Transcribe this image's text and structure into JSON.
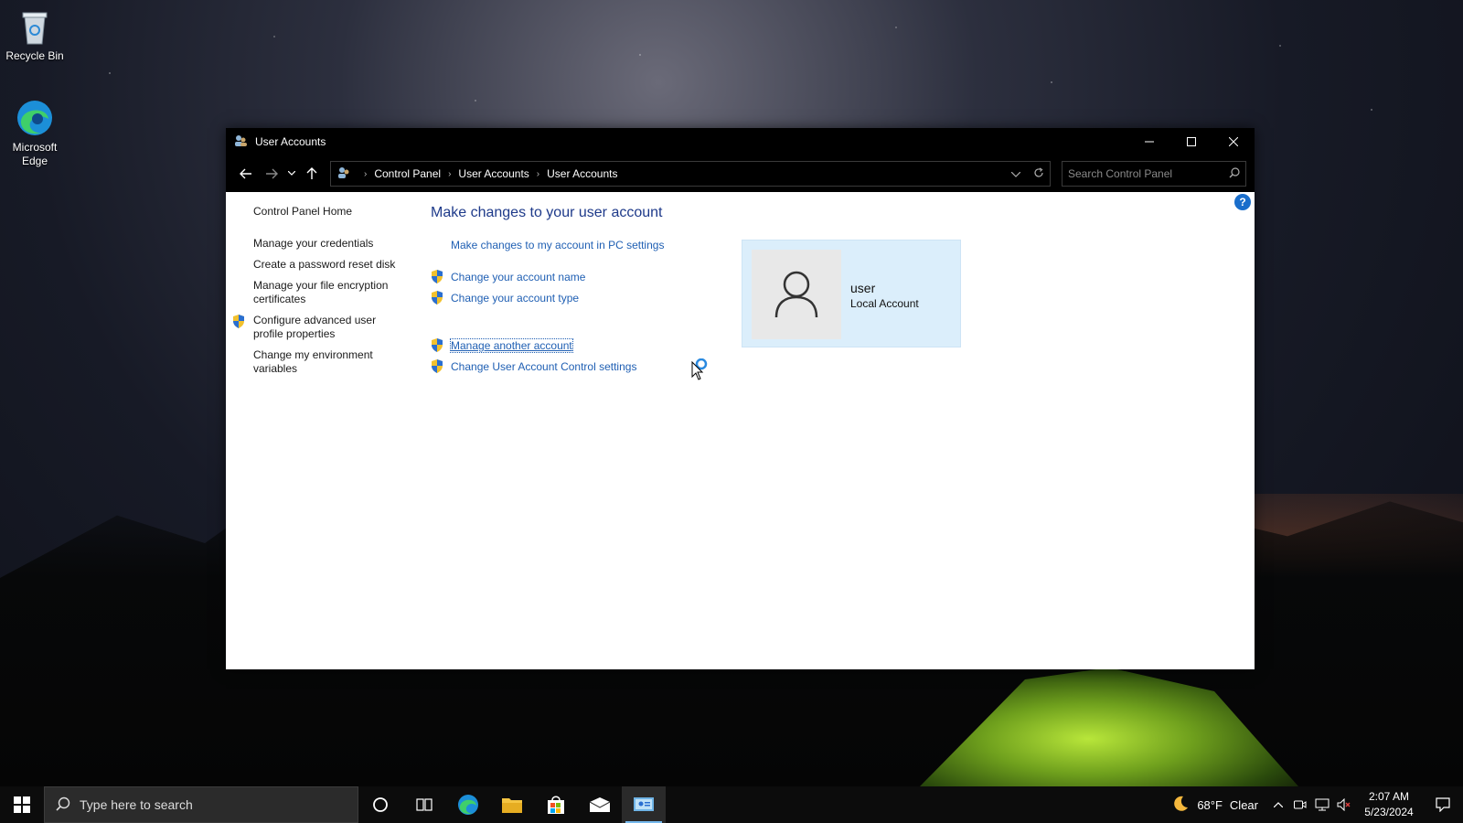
{
  "desktop": {
    "icons": [
      {
        "label": "Recycle Bin"
      },
      {
        "label": "Microsoft Edge"
      }
    ]
  },
  "window": {
    "title": "User Accounts",
    "breadcrumb": [
      "Control Panel",
      "User Accounts",
      "User Accounts"
    ],
    "search_placeholder": "Search Control Panel",
    "left_links": [
      "Control Panel Home",
      "Manage your credentials",
      "Create a password reset disk",
      "Manage your file encryption certificates",
      "Configure advanced user profile properties",
      "Change my environment variables"
    ],
    "main": {
      "title": "Make changes to your user account",
      "actions": [
        "Make changes to my account in PC settings",
        "Change your account name",
        "Change your account type",
        "Manage another account",
        "Change User Account Control settings"
      ]
    },
    "user": {
      "name": "user",
      "type": "Local Account"
    }
  },
  "taskbar": {
    "search_placeholder": "Type here to search",
    "weather": {
      "temp": "68°F",
      "condition": "Clear"
    },
    "clock": {
      "time": "2:07 AM",
      "date": "5/23/2024"
    }
  },
  "colors": {
    "link": "#1f5fb3",
    "title": "#1e3a8a",
    "card": "#dbeefb",
    "accent": "#76b9ed"
  }
}
